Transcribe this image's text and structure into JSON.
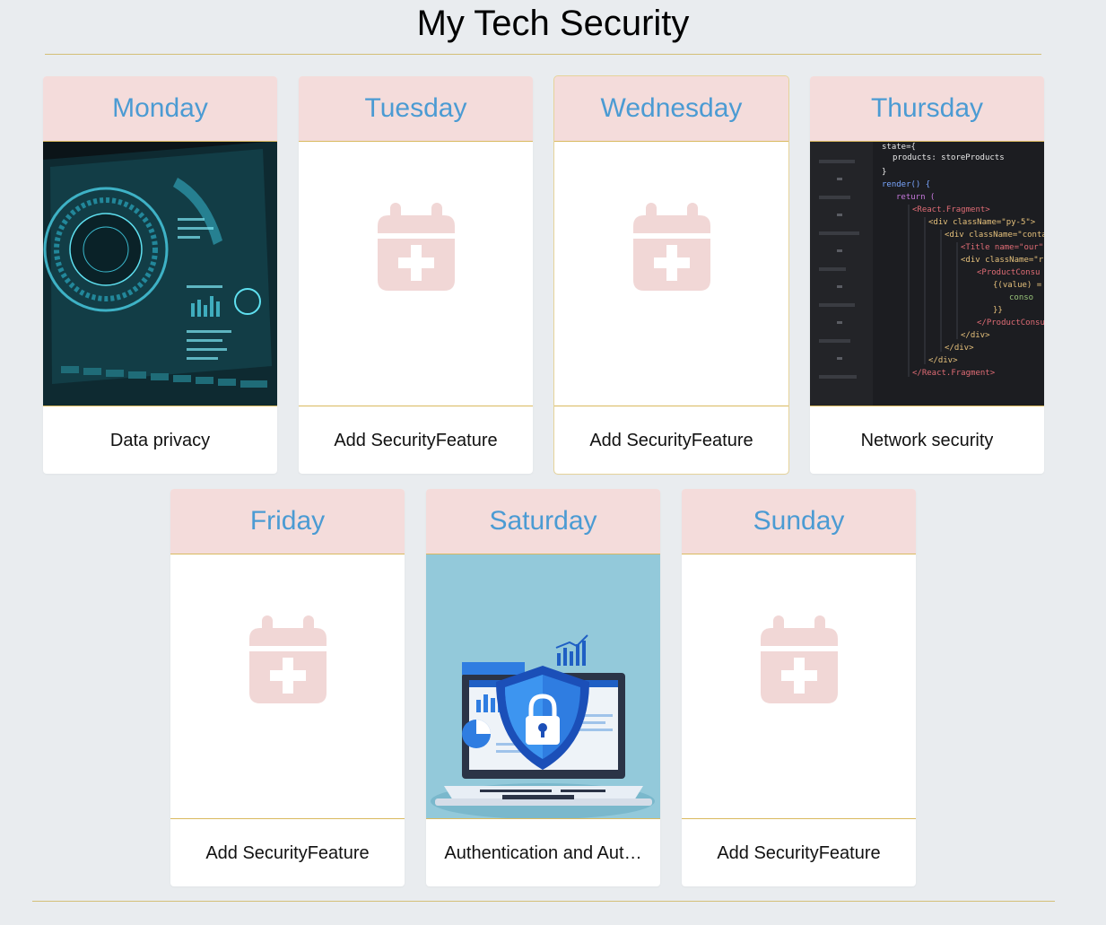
{
  "app": {
    "title": "My Tech Security"
  },
  "days": [
    {
      "day": "Monday",
      "feature": "Data privacy",
      "media": "hud-interface-image"
    },
    {
      "day": "Tuesday",
      "feature": "Add SecurityFeature",
      "media": "add-calendar-icon"
    },
    {
      "day": "Wednesday",
      "feature": "Add SecurityFeature",
      "media": "add-calendar-icon"
    },
    {
      "day": "Thursday",
      "feature": "Network security",
      "media": "code-editor-image"
    },
    {
      "day": "Friday",
      "feature": "Add SecurityFeature",
      "media": "add-calendar-icon"
    },
    {
      "day": "Saturday",
      "feature": "Authentication and Aut…",
      "media": "laptop-shield-image"
    },
    {
      "day": "Sunday",
      "feature": "Add SecurityFeature",
      "media": "add-calendar-icon"
    }
  ],
  "colors": {
    "background": "#e9ecef",
    "card_header": "#f4dcdb",
    "day_text": "#4b9bd3",
    "divider": "#d4bf77",
    "add_icon": "#f1d7d6"
  }
}
